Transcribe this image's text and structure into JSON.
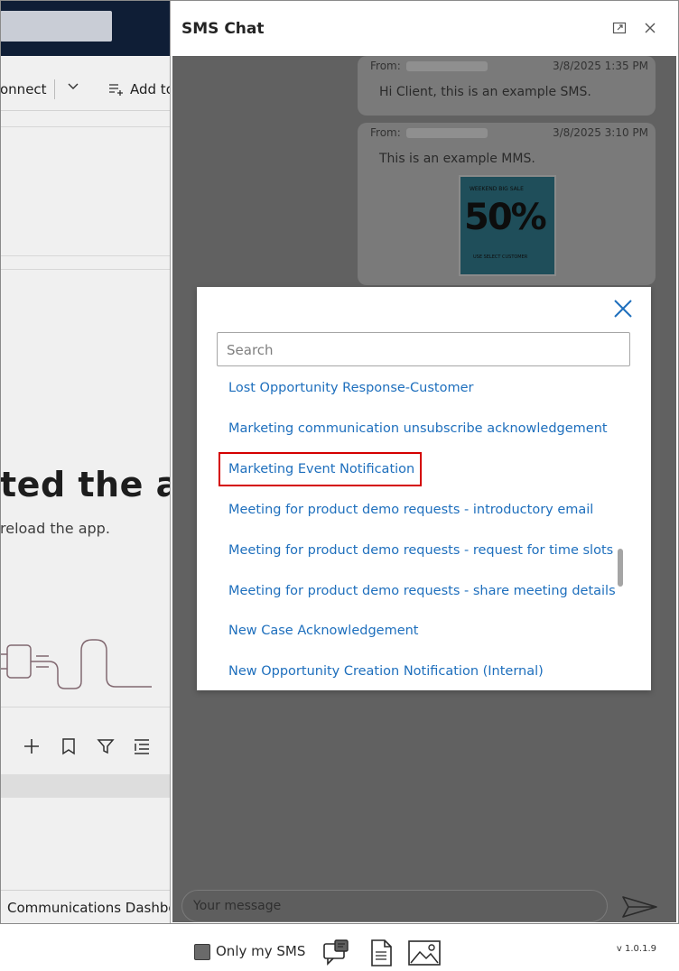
{
  "background_app": {
    "cmd_connect": "onnect",
    "cmd_add": "Add to",
    "error_heading": "ted the ap",
    "error_sub": "reload the app.",
    "bottom_tab": "Communications Dashboa"
  },
  "sms_panel": {
    "title": "SMS Chat",
    "messages": [
      {
        "from_label": "From:",
        "timestamp": "3/8/2025 1:35 PM",
        "body": "Hi Client, this is an example SMS."
      },
      {
        "from_label": "From:",
        "timestamp": "3/8/2025 3:10 PM",
        "body": "This is an example MMS.",
        "image_text": {
          "top": "WEEKEND BIG SALE",
          "big": "50%",
          "bottom": "USE SELECT CUSTOMER"
        }
      }
    ],
    "composer": {
      "placeholder": "Your message"
    },
    "only_my_sms_label": "Only my SMS",
    "version": "v 1.0.1.9"
  },
  "template_modal": {
    "search": {
      "placeholder": "Search",
      "value": ""
    },
    "templates": [
      "Lost Opportunity Response-Customer",
      "Marketing communication unsubscribe acknowledgement",
      "Marketing Event Notification",
      "Meeting for product demo requests - introductory email",
      "Meeting for product demo requests - request for time slots",
      "Meeting for product demo requests - share meeting details",
      "New Case Acknowledgement",
      "New Opportunity Creation Notification (Internal)"
    ],
    "highlighted_index": 2
  },
  "colors": {
    "link": "#1e6fbd",
    "highlight": "#d40000",
    "overlay": "#616161",
    "topbar": "#0f1e36"
  },
  "icons": [
    "expand-icon",
    "close-icon",
    "plug-illustration",
    "send-icon",
    "sms-template-icon",
    "document-icon",
    "image-icon"
  ]
}
